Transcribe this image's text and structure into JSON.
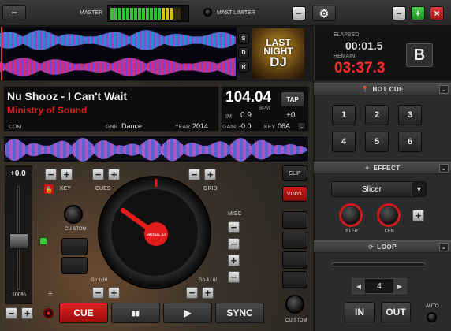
{
  "topbar": {
    "master_label": "MASTER",
    "limiter_label": "MAST LIMITER",
    "minimize": "−",
    "maximize": "+",
    "close": "×",
    "panel_minimize": "−"
  },
  "sdr": [
    "S",
    "D",
    "R"
  ],
  "album_art": {
    "lines": [
      "LAST",
      "NIGHT",
      "DJ"
    ]
  },
  "deck_letter": "B",
  "timer": {
    "elapsed_label": "ELAPSED",
    "elapsed": "00:01.5",
    "remain_label": "REMAIN",
    "remain": "03:37.3"
  },
  "track": {
    "title": "Nu Shooz - I Can't Wait",
    "artist": "Ministry of Sound",
    "com_label": "COM",
    "genre_label": "GNR",
    "genre": "Dance",
    "year_label": "YEAR",
    "year": "2014"
  },
  "bpm": {
    "value": "104.04",
    "unit": "BPM",
    "tap": "TAP",
    "im_label": "IM",
    "im_value": "0.9",
    "pitch": "+0",
    "gain_label": "GAIN",
    "gain": "-0.0",
    "key_label": "KEY",
    "key": "06A"
  },
  "pitch": {
    "value": "+0.0",
    "percent": "100%"
  },
  "loop_controls": {
    "key_label": "KEY",
    "cues_label": "CUES",
    "grid_label": "GRID",
    "custom_label": "CU STOM",
    "misc_label": "MISC",
    "custom_bottom_label": "CU STOM",
    "slip": "SLIP",
    "vinyl": "VINYL",
    "left_gain": "Go 1/16",
    "right_gain": "Go 4 / 6!",
    "equals": "="
  },
  "platter": {
    "label": "VIRTUAL DJ"
  },
  "transport": {
    "cue": "CUE",
    "pause": "▮▮",
    "play": "▶",
    "sync": "SYNC"
  },
  "hotcue": {
    "header": "HOT CUE",
    "buttons": [
      "1",
      "2",
      "3",
      "4",
      "5",
      "6"
    ]
  },
  "effect": {
    "header": "EFFECT",
    "selected": "Slicer",
    "step_label": "STEP",
    "len_label": "LEN",
    "add": "+"
  },
  "loop": {
    "header": "LOOP",
    "size": "4",
    "in": "IN",
    "out": "OUT",
    "auto": "AUTO"
  },
  "colors": {
    "accent_red": "#e21b1b",
    "timer_red": "#ff2a2a",
    "cue_red": "#c8141a",
    "vinyl_red": "#b40f10",
    "green": "#3ec43e"
  }
}
